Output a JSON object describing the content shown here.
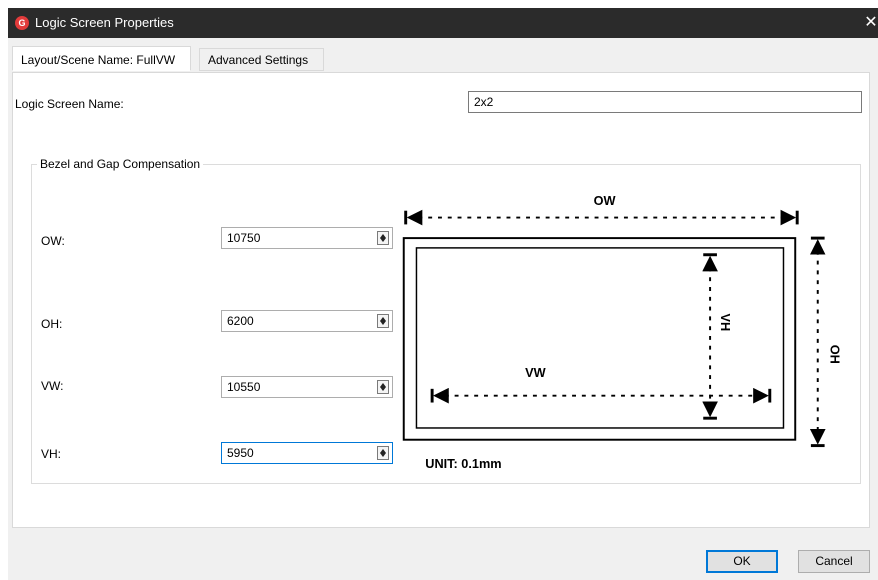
{
  "window": {
    "title": "Logic Screen Properties",
    "app_icon": "G",
    "close_glyph": "✕"
  },
  "tabs": [
    {
      "label": "Layout/Scene Name: FullVW",
      "active": true
    },
    {
      "label": "Advanced Settings",
      "active": false
    }
  ],
  "logic_screen": {
    "label": "Logic Screen Name:",
    "value": "2x2"
  },
  "bezel_group": {
    "title": "Bezel and Gap Compensation",
    "fields": [
      {
        "label": "OW:",
        "value": "10750"
      },
      {
        "label": "OH:",
        "value": "6200"
      },
      {
        "label": "VW:",
        "value": "10550"
      },
      {
        "label": "VH:",
        "value": "5950"
      }
    ]
  },
  "diagram": {
    "ow": "OW",
    "oh": "OH",
    "vw": "VW",
    "vh": "VH",
    "unit": "UNIT: 0.1mm"
  },
  "buttons": {
    "ok": "OK",
    "cancel": "Cancel"
  }
}
